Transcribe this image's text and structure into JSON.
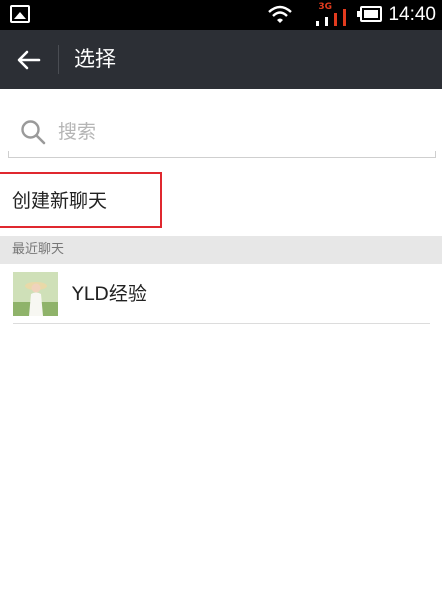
{
  "status_bar": {
    "time": "14:40",
    "network_label": "3G",
    "battery_level": 1.0,
    "icons": [
      "gallery-icon",
      "wifi-icon",
      "signal-icon",
      "battery-icon"
    ]
  },
  "app_bar": {
    "title": "选择",
    "back_icon": "arrow-left-icon",
    "background": "#2c2f35"
  },
  "search": {
    "placeholder": "搜索",
    "icon": "search-icon"
  },
  "new_chat": {
    "label": "创建新聊天",
    "highlight_color": "#e0282f"
  },
  "recent": {
    "header": "最近聊天",
    "items": [
      {
        "name": "YLD经验",
        "avatar": "photo-avatar"
      }
    ]
  }
}
